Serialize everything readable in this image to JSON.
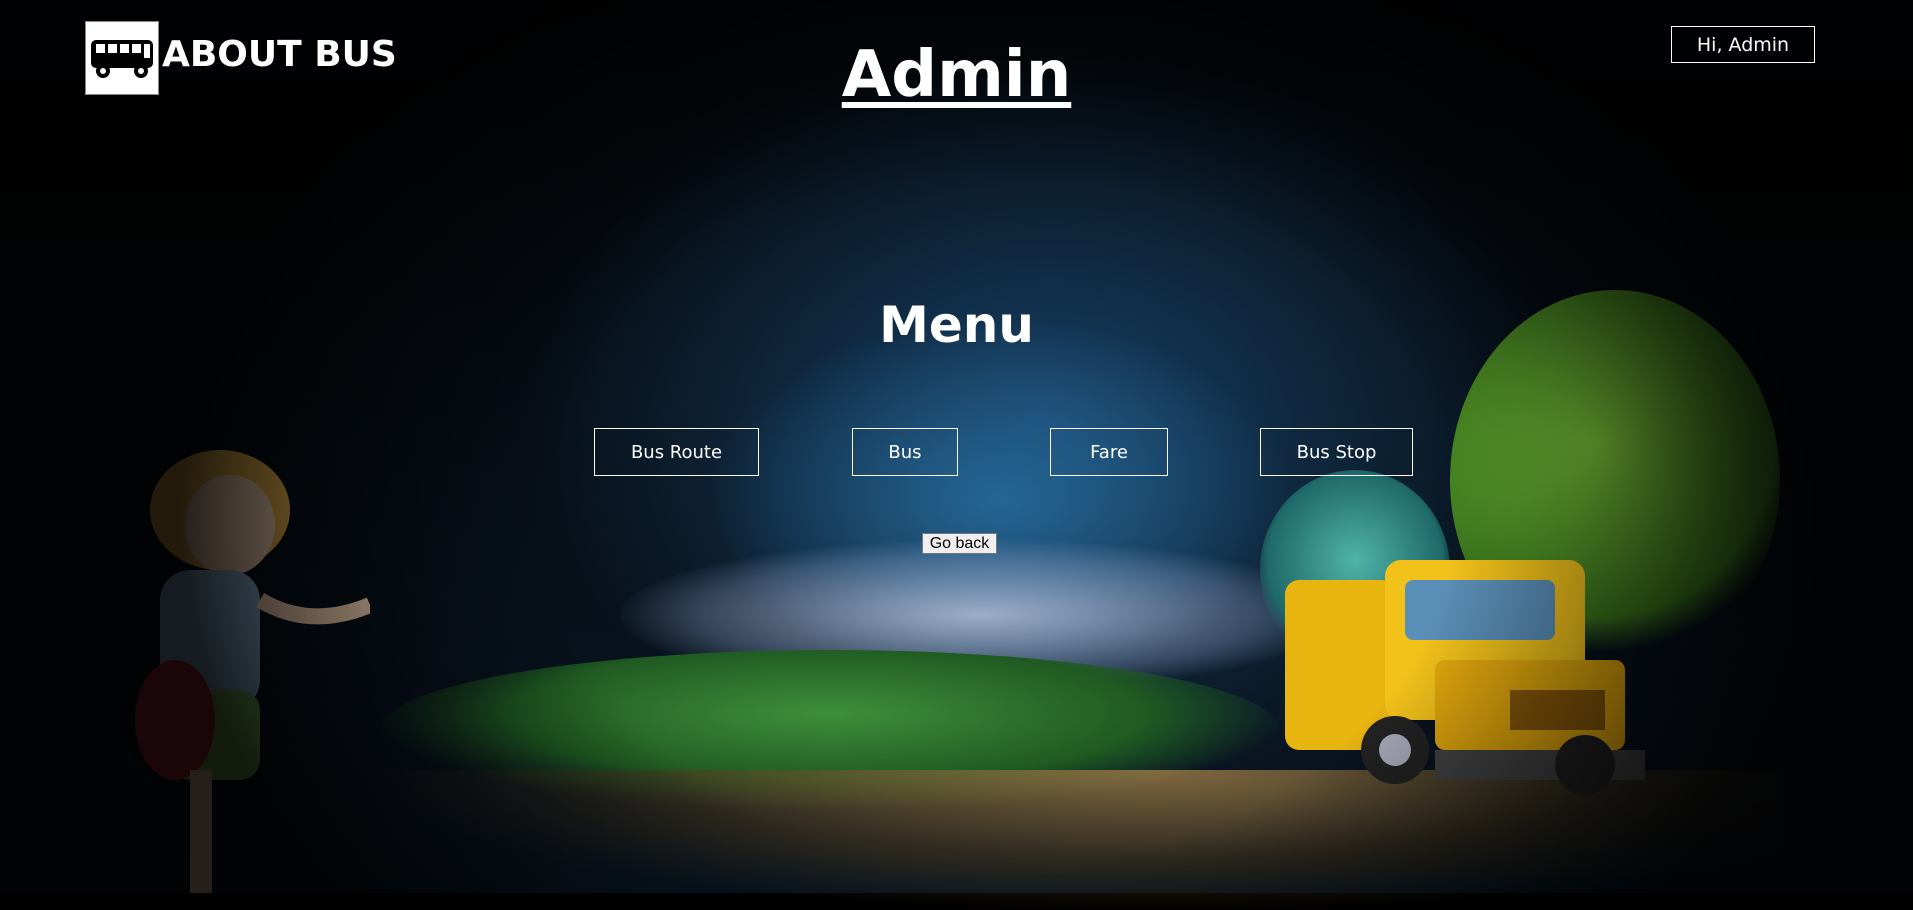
{
  "header": {
    "brand": "ABOUT BUS",
    "title": "Admin",
    "greeting": "Hi, Admin"
  },
  "menu": {
    "heading": "Menu",
    "items": [
      {
        "label": "Bus Route"
      },
      {
        "label": "Bus"
      },
      {
        "label": "Fare"
      },
      {
        "label": "Bus Stop"
      }
    ]
  },
  "actions": {
    "go_back": "Go back"
  },
  "icons": {
    "logo": "bus-icon"
  }
}
